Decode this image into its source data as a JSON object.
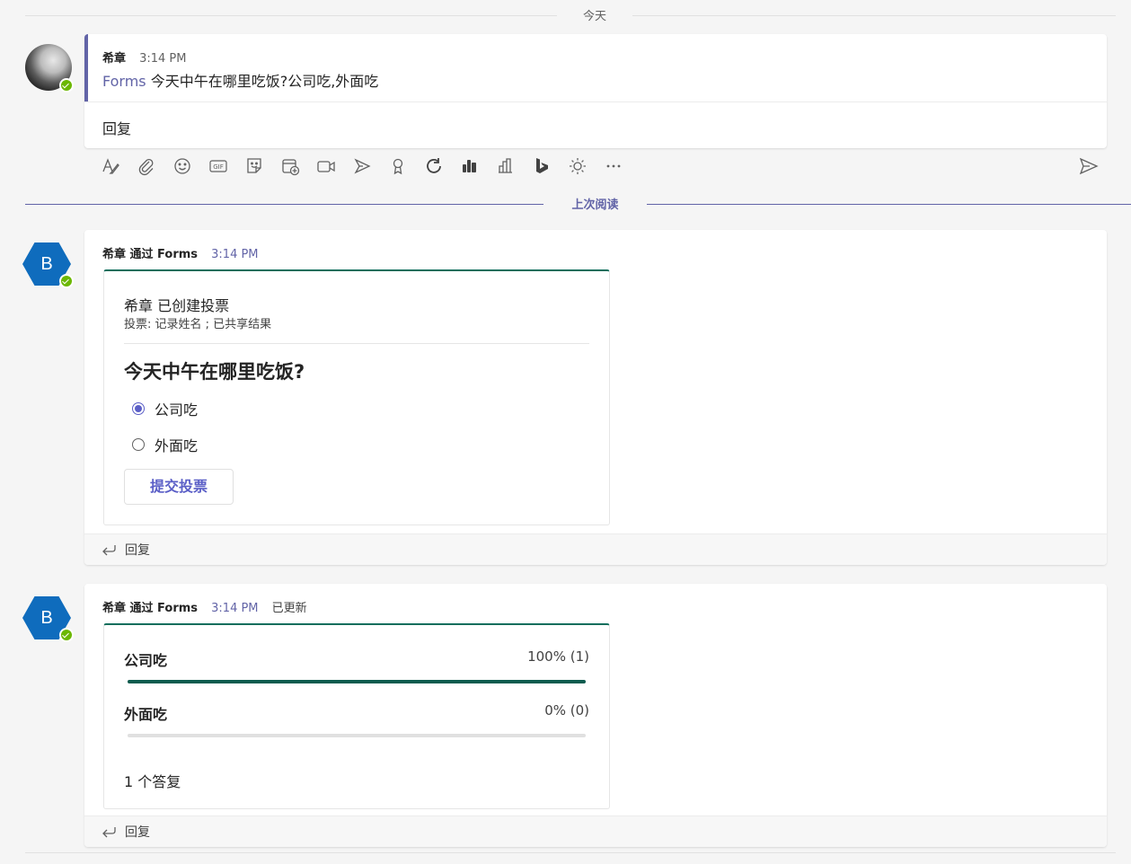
{
  "date_divider": {
    "label": "今天"
  },
  "first_message": {
    "sender": "希章",
    "time": "3:14 PM",
    "app_link": "Forms",
    "text": " 今天中午在哪里吃饭?公司吃,外面吃",
    "reply_label": "回复"
  },
  "compose_toolbar": {
    "icons": [
      "format-icon",
      "attach-icon",
      "emoji-icon",
      "gif-icon",
      "sticker-icon",
      "schedule-meeting-icon",
      "video-icon",
      "stream-icon",
      "praise-icon",
      "loop-icon",
      "approvals-icon",
      "insights-icon",
      "bing-icon",
      "weather-icon",
      "more-options-icon"
    ],
    "send_icon": "send-icon"
  },
  "last_read_divider": {
    "label": "上次阅读",
    "color": "#6264a7"
  },
  "poll_message": {
    "avatar_letter": "B",
    "sender": "希章 通过 Forms",
    "time": "3:14 PM",
    "creator_line": "希章 已创建投票",
    "subtitle": "投票: 记录姓名 ; 已共享结果",
    "question": "今天中午在哪里吃饭?",
    "options": [
      {
        "label": "公司吃",
        "selected": true
      },
      {
        "label": "外面吃",
        "selected": false
      }
    ],
    "submit_label": "提交投票",
    "reply_label": "回复"
  },
  "results_message": {
    "avatar_letter": "B",
    "sender": "希章 通过 Forms",
    "time": "3:14 PM",
    "updated_label": "已更新",
    "results": [
      {
        "label": "公司吃",
        "value_text": "100% (1)",
        "fraction": 1.0,
        "color": "#0e5c4f"
      },
      {
        "label": "外面吃",
        "value_text": "0% (0)",
        "fraction": 0.0,
        "color": "#0e5c4f"
      }
    ],
    "response_count": "1 个答复",
    "reply_label": "回复"
  },
  "colors": {
    "accent": "#6264a7",
    "brand_blue": "#0f6cbd",
    "forms_teal": "#0e6e5c",
    "presence_green": "#6bb700"
  }
}
